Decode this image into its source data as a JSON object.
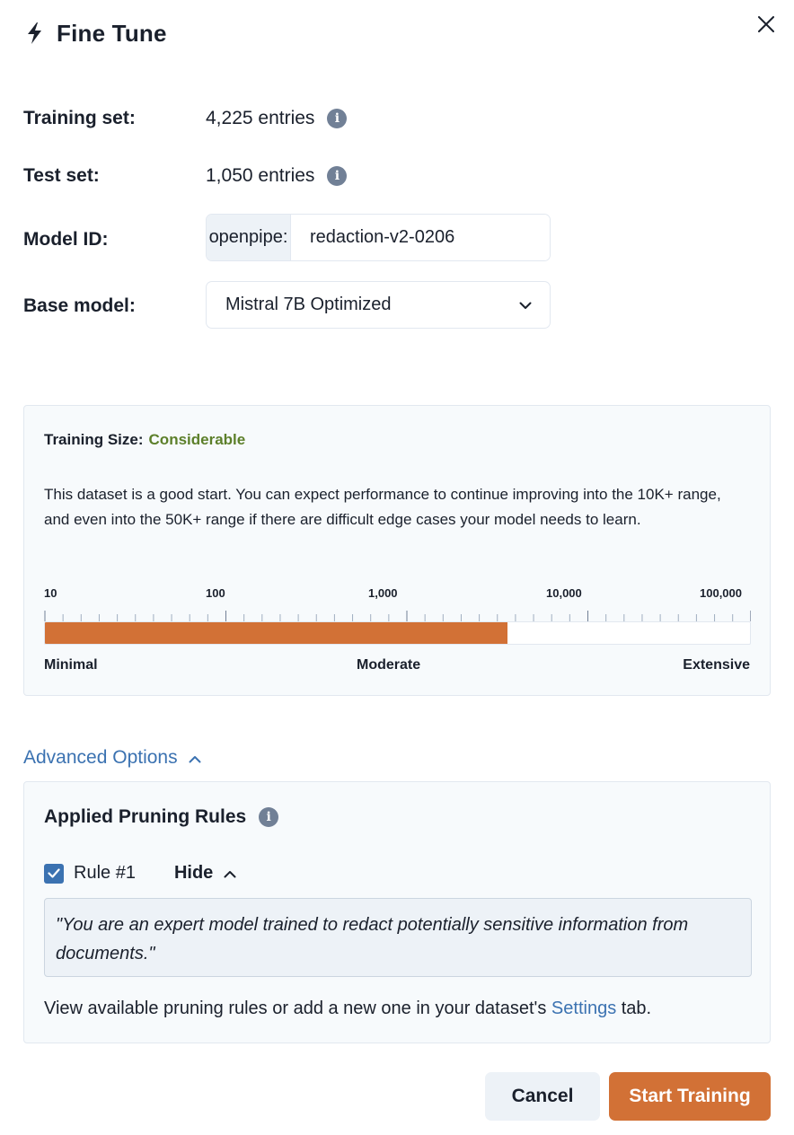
{
  "header": {
    "title": "Fine Tune",
    "icon": "lightning-bolt-icon",
    "close_icon": "close-icon"
  },
  "rows": {
    "training_set": {
      "label": "Training set:",
      "value": "4,225 entries"
    },
    "test_set": {
      "label": "Test set:",
      "value": "1,050 entries"
    },
    "model_id": {
      "label": "Model ID:",
      "prefix": "openpipe:",
      "value": "redaction-v2-0206"
    },
    "base_model": {
      "label": "Base model:",
      "value": "Mistral 7B Optimized"
    }
  },
  "training_size": {
    "label": "Training Size:",
    "value": "Considerable",
    "value_color": "#5c7f2a",
    "description": "This dataset is a good start. You can expect performance to continue improving into the 10K+ range, and even into the 50K+ range if there are difficult edge cases your model needs to learn.",
    "scale_labels": [
      "10",
      "100",
      "1,000",
      "10,000",
      "100,000"
    ],
    "fill_fraction": 0.656,
    "fill_color": "#d27136",
    "range_labels": {
      "min": "Minimal",
      "mid": "Moderate",
      "max": "Extensive"
    }
  },
  "advanced": {
    "toggle_label": "Advanced Options",
    "pruning_title": "Applied Pruning Rules",
    "rule": {
      "label": "Rule #1",
      "checked": true,
      "hide_label": "Hide"
    },
    "quote": "\"You are an expert model trained to redact potentially sensitive information from documents.\"",
    "footer_prefix": "View available pruning rules or add a new one in your dataset's ",
    "footer_link": "Settings",
    "footer_suffix": " tab."
  },
  "buttons": {
    "cancel": "Cancel",
    "start": "Start Training"
  },
  "colors": {
    "accent": "#d27136",
    "link": "#3b72b1"
  }
}
